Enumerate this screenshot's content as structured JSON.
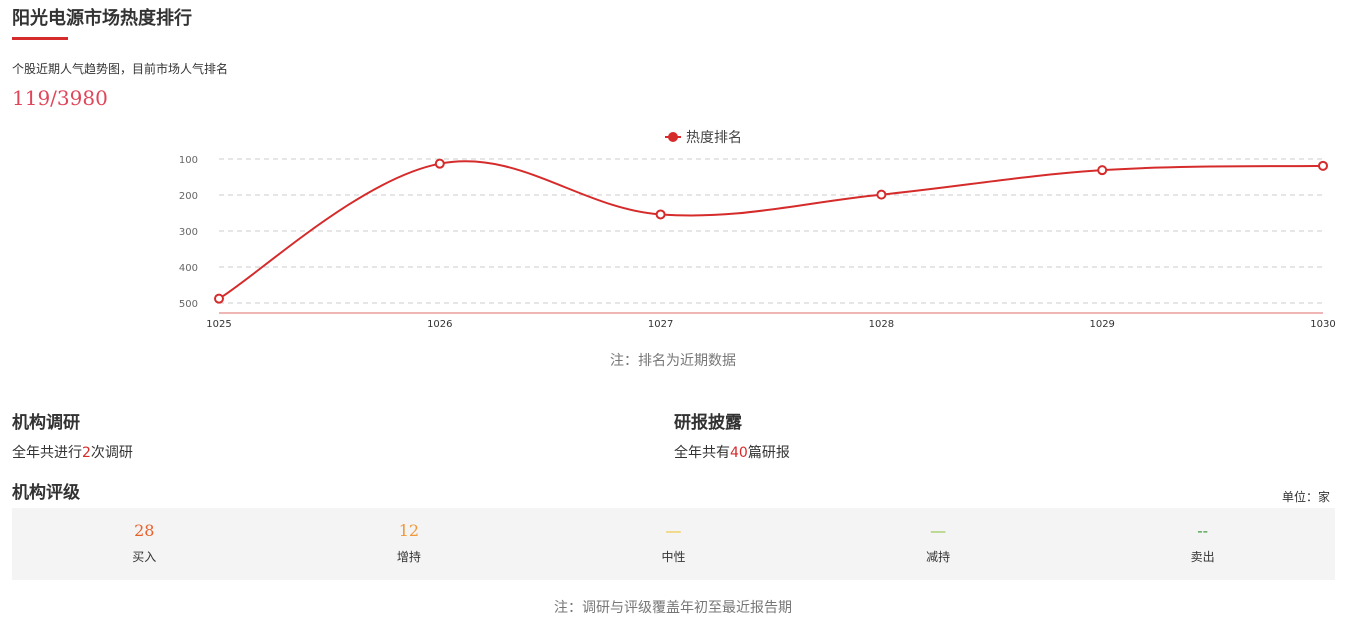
{
  "header": {
    "title": "阳光电源市场热度排行",
    "subtitle": "个股近期人气趋势图，目前市场人气排名",
    "rank_display": "119/3980"
  },
  "chart_data": {
    "type": "line",
    "legend": "热度排名",
    "x": [
      "1025",
      "1026",
      "1027",
      "1028",
      "1029",
      "1030"
    ],
    "series": [
      {
        "name": "热度排名",
        "values": [
          488,
          113,
          254,
          199,
          131,
          119
        ]
      }
    ],
    "y_ticks": [
      "100",
      "200",
      "300",
      "400",
      "500"
    ],
    "ylim": [
      100,
      500
    ],
    "y_inverted": true,
    "grid": true,
    "legend_position": "top-center",
    "color": "#d52b2b"
  },
  "chart_note": "注：排名为近期数据",
  "research": {
    "title": "机构调研",
    "text_before": "全年共进行",
    "count": "2",
    "text_after": "次调研"
  },
  "reports": {
    "title": "研报披露",
    "text_before": "全年共有",
    "count": "40",
    "text_after": "篇研报"
  },
  "ratings": {
    "title": "机构评级",
    "unit": "单位：家",
    "items": [
      {
        "value": "28",
        "label": "买入",
        "color": "#e8612c"
      },
      {
        "value": "12",
        "label": "增持",
        "color": "#f0983a"
      },
      {
        "value": "—",
        "label": "中性",
        "color": "#f0c030"
      },
      {
        "value": "—",
        "label": "减持",
        "color": "#8cbf3f"
      },
      {
        "value": "--",
        "label": "卖出",
        "color": "#3f9a3a"
      }
    ]
  },
  "bottom_note": "注：调研与评级覆盖年初至最近报告期"
}
